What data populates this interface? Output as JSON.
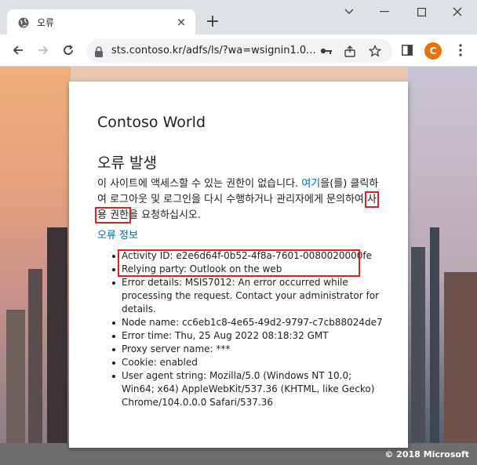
{
  "browser": {
    "tab_title": "오류",
    "tab_close": "×",
    "new_tab": "+",
    "url": "sts.contoso.kr/adfs/ls/?wa=wsignin1.0...",
    "profile_initial": "C",
    "profile_color": "#e8710a",
    "icons": [
      "globe-icon",
      "back-arrow-icon",
      "forward-arrow-icon",
      "reload-icon",
      "lock-icon",
      "key-icon",
      "share-icon",
      "star-icon",
      "sidebar-icon",
      "menu-icon",
      "minimize-icon",
      "maximize-icon",
      "close-icon",
      "chevron-down-icon"
    ]
  },
  "card": {
    "brand": "Contoso World",
    "heading": "오류 발생",
    "message": {
      "part1": "이 사이트에 액세스할 수 있는 권한이 없습니다. ",
      "link": "여기",
      "part2": "을(를) 클릭하여 로그아웃 및 로그인을 다시 수행하거나 관리자에게 문의하여 ",
      "highlight": "사용 권한",
      "part3": "을 요청하십시오."
    },
    "error_info_link": "오류 정보",
    "details": [
      "Activity ID: e2e6d64f-0b52-4f8a-7601-0080020000fe",
      "Relying party: Outlook on the web",
      "Error details: MSIS7012: An error occurred while processing the request. Contact your administrator for details.",
      "Node name: cc6eb1c8-4e65-49d2-9797-c7cb88024de7",
      "Error time: Thu, 25 Aug 2022 08:18:32 GMT",
      "Proxy server name: ***",
      "Cookie: enabled",
      "User agent string: Mozilla/5.0 (Windows NT 10.0; Win64; x64) AppleWebKit/537.36 (KHTML, like Gecko) Chrome/104.0.0.0 Safari/537.36"
    ]
  },
  "footer": {
    "copyright": "© 2018 Microsoft"
  },
  "colors": {
    "link": "#0067b8",
    "highlight_box": "#e02020"
  }
}
